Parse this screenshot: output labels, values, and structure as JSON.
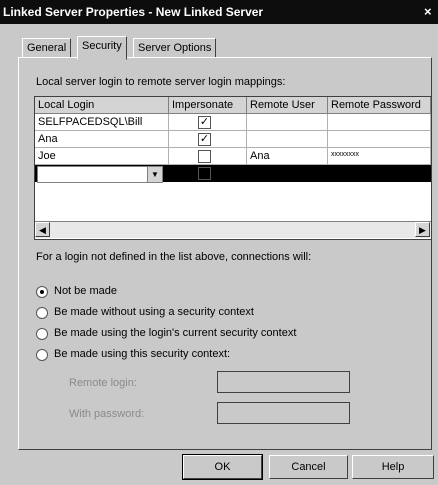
{
  "window": {
    "title": "Linked Server Properties - New Linked Server",
    "close_glyph": "×"
  },
  "tabs": [
    {
      "label": "General"
    },
    {
      "label": "Security",
      "active": true
    },
    {
      "label": "Server Options"
    }
  ],
  "security": {
    "mapping_label": "Local server login to remote server login mappings:",
    "columns": [
      "Local Login",
      "Impersonate",
      "Remote User",
      "Remote Password"
    ],
    "rows": [
      {
        "local_login": "SELFPACEDSQL\\Bill",
        "impersonate": true,
        "remote_user": "",
        "remote_password": ""
      },
      {
        "local_login": "Ana",
        "impersonate": true,
        "remote_user": "",
        "remote_password": ""
      },
      {
        "local_login": "Joe",
        "impersonate": false,
        "remote_user": "Ana",
        "remote_password": "xxxxxxxx"
      }
    ],
    "not_defined_label": "For a login not defined in the list above, connections will:",
    "options": [
      {
        "label": "Not be made",
        "selected": true
      },
      {
        "label": "Be made without using a security context",
        "selected": false
      },
      {
        "label": "Be made using the login's current security context",
        "selected": false
      },
      {
        "label": "Be made using this security context:",
        "selected": false
      }
    ],
    "remote_login_label": "Remote login:",
    "with_password_label": "With password:",
    "remote_login_value": "",
    "with_password_value": ""
  },
  "buttons": {
    "ok": "OK",
    "cancel": "Cancel",
    "help": "Help"
  },
  "icons": {
    "check": "check-icon",
    "dropdown": "chevron-down-icon",
    "scroll_left": "arrow-left-icon",
    "scroll_right": "arrow-right-icon"
  }
}
